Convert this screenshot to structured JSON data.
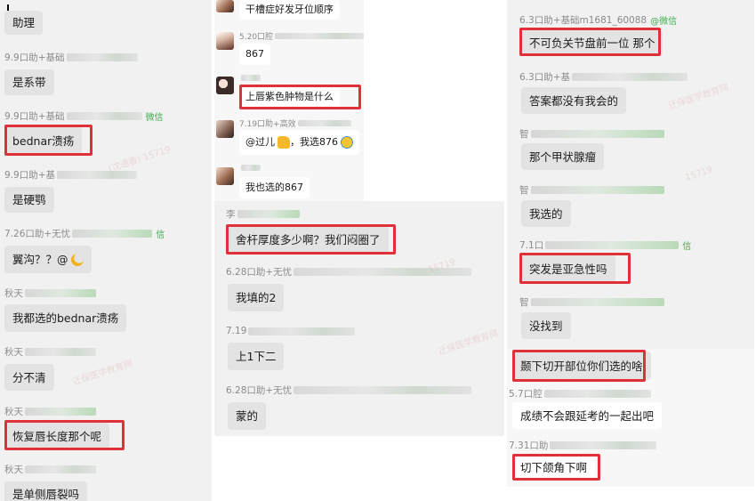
{
  "col1": {
    "messages": [
      {
        "sender": "",
        "text": "助理"
      },
      {
        "sender": "9.9口助+基础",
        "text": "是系带"
      },
      {
        "sender": "9.9口助+基础",
        "tag": "微信",
        "text": "bednar溃疡",
        "highlight": true
      },
      {
        "sender": "9.9口助+基",
        "text": "是硬鹗"
      },
      {
        "sender": "7.26口助+无忧",
        "tag": "信",
        "text": "翼沟？？@",
        "emoji": "moon-emoji"
      },
      {
        "sender": "秋天",
        "text": "我都选的bednar溃疡"
      },
      {
        "sender": "秋天",
        "text": "分不清"
      },
      {
        "sender": "秋天",
        "text": "恢复唇长度那个呢",
        "highlight": true
      },
      {
        "sender": "秋天",
        "text": "是单侧唇裂吗"
      }
    ]
  },
  "col2a": {
    "messages": [
      {
        "sender": "",
        "text": "干槽症好发牙位顺序"
      },
      {
        "sender": "5.20口腔",
        "text": "867"
      },
      {
        "sender": "",
        "text": "上唇紫色肿物是什么",
        "highlight": true
      },
      {
        "sender": "7.19口助+高效",
        "text": "@过儿",
        "emoji": "thumbs-up-emoji",
        "text2": "，我选876",
        "emoji2": "face-emoji"
      },
      {
        "sender": "",
        "text": "我也选的867"
      }
    ]
  },
  "col2b": {
    "messages": [
      {
        "sender": "李",
        "text": "舍杆厚度多少啊？我们闷圈了",
        "highlight": true
      },
      {
        "sender": "6.28口助+无忧",
        "text": "我填的2"
      },
      {
        "sender": "7.19",
        "text": "上1下二"
      },
      {
        "sender": "6.28口助+无忧",
        "text": "蒙的"
      }
    ]
  },
  "col3a": {
    "messages": [
      {
        "sender": "6.3口助+基础m1681_60088",
        "tag": "@微信",
        "text": "不可负关节盘前一位 那个",
        "highlight": true
      },
      {
        "sender": "6.3口助+基",
        "text": "答案都没有我会的"
      },
      {
        "sender": "智",
        "text": "那个甲状腺瘤"
      },
      {
        "sender": "智",
        "text": "我选的"
      },
      {
        "sender": "7.1口",
        "tag": "信",
        "text": "突发是亚急性吗",
        "highlight": true
      },
      {
        "sender": "智",
        "text": "没找到"
      }
    ]
  },
  "col3b": {
    "messages": [
      {
        "sender": "",
        "text": "颞下切开部位你们选的啥",
        "highlight": true
      },
      {
        "sender": "5.7口腔",
        "text": "成绩不会跟延考的一起出吧"
      },
      {
        "sender": "7.31口助",
        "text": "切下颌角下啊",
        "highlight": true
      }
    ]
  },
  "watermarks": [
    "迁保医学教育网",
    "(沈通香) 15719",
    "15719",
    "迁保医学教育网"
  ],
  "colors": {
    "highlight": "#e0313b",
    "wechat_tag": "#3fae4f",
    "bubble": "#e3e3e3"
  }
}
